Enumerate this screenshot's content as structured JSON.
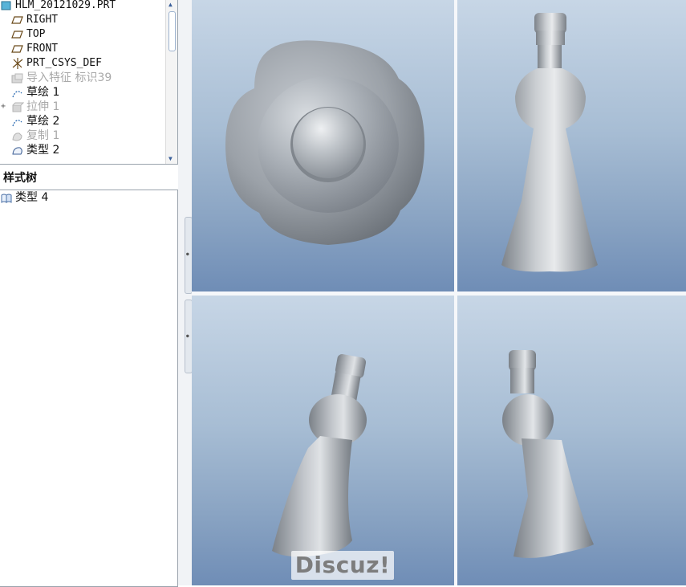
{
  "model_tree": {
    "items": [
      {
        "label": "HLM_20121029.PRT",
        "icon": "part-icon",
        "dimmed": false,
        "expander": ""
      },
      {
        "label": "RIGHT",
        "icon": "datum-plane-icon",
        "dimmed": false,
        "expander": ""
      },
      {
        "label": "TOP",
        "icon": "datum-plane-icon",
        "dimmed": false,
        "expander": ""
      },
      {
        "label": "FRONT",
        "icon": "datum-plane-icon",
        "dimmed": false,
        "expander": ""
      },
      {
        "label": "PRT_CSYS_DEF",
        "icon": "coordinate-system-icon",
        "dimmed": false,
        "expander": ""
      },
      {
        "label": "导入特征 标识39",
        "icon": "import-feature-icon",
        "dimmed": true,
        "expander": ""
      },
      {
        "label": "草绘 1",
        "icon": "sketch-icon",
        "dimmed": false,
        "expander": ""
      },
      {
        "label": "拉伸 1",
        "icon": "extrude-icon",
        "dimmed": true,
        "expander": "+"
      },
      {
        "label": "草绘 2",
        "icon": "sketch-icon",
        "dimmed": false,
        "expander": ""
      },
      {
        "label": "复制 1",
        "icon": "copy-icon",
        "dimmed": true,
        "expander": ""
      },
      {
        "label": "类型 2",
        "icon": "style-icon",
        "dimmed": false,
        "expander": ""
      }
    ]
  },
  "style_tree": {
    "title": "样式树",
    "items": [
      {
        "label": "类型 4",
        "icon": "style-feature-icon"
      }
    ]
  },
  "watermark": "Discuz!",
  "colors": {
    "viewport_top": "#c7d6e6",
    "viewport_bottom": "#6f8db6",
    "model": "#a9afb6",
    "dimmed_text": "#a9a9a9"
  }
}
